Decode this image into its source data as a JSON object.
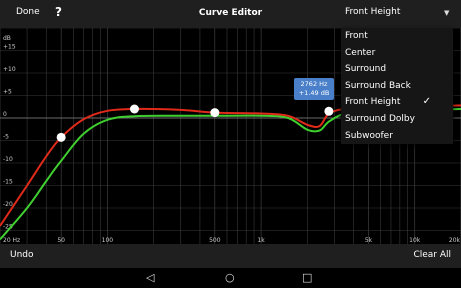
{
  "toolbar": {
    "done_label": "Done",
    "help_label": "?",
    "title": "Curve Editor",
    "preset_value": "Front Height"
  },
  "graph": {
    "y_unit": "dB",
    "y_ticks": [
      "+15",
      "+10",
      "+5",
      "0",
      "-5",
      "-10",
      "-15",
      "-20",
      "-25"
    ],
    "x_ticks": [
      "20 Hz",
      "50",
      "100",
      "500",
      "1k",
      "5k",
      "10k",
      "20k"
    ],
    "colors": {
      "red_curve": "#e02a1a",
      "green_curve": "#3fcf2f",
      "grid": "#3a3a3a"
    },
    "tooltip": {
      "freq": "2762 Hz",
      "gain": "+1.49 dB"
    }
  },
  "chart_data": {
    "type": "line",
    "xscale": "log",
    "xlim": [
      20,
      20000
    ],
    "ylim": [
      -28,
      20
    ],
    "control_points": [
      {
        "x": 50,
        "y": -4.3
      },
      {
        "x": 150,
        "y": 2.0
      },
      {
        "x": 500,
        "y": 1.2
      },
      {
        "x": 2762,
        "y": 1.49
      }
    ],
    "series": [
      {
        "color": "#e02a1a",
        "points": [
          [
            20,
            -24
          ],
          [
            30,
            -15
          ],
          [
            40,
            -8.5
          ],
          [
            50,
            -4.3
          ],
          [
            70,
            -0.3
          ],
          [
            100,
            1.6
          ],
          [
            150,
            2.0
          ],
          [
            300,
            1.8
          ],
          [
            500,
            1.2
          ],
          [
            1000,
            1.0
          ],
          [
            1500,
            0.5
          ],
          [
            2000,
            -1.5
          ],
          [
            2400,
            -1.8
          ],
          [
            2762,
            1.0
          ],
          [
            3500,
            2.0
          ],
          [
            5000,
            2.2
          ],
          [
            10000,
            2.5
          ],
          [
            20000,
            2.8
          ]
        ]
      },
      {
        "color": "#3fcf2f",
        "points": [
          [
            20,
            -27
          ],
          [
            30,
            -20
          ],
          [
            40,
            -14
          ],
          [
            50,
            -9.5
          ],
          [
            70,
            -3.5
          ],
          [
            100,
            -0.4
          ],
          [
            150,
            0.4
          ],
          [
            300,
            0.5
          ],
          [
            500,
            0.5
          ],
          [
            1000,
            0.5
          ],
          [
            1500,
            0.0
          ],
          [
            2000,
            -2.6
          ],
          [
            2400,
            -2.8
          ],
          [
            2762,
            -0.8
          ],
          [
            3500,
            1.0
          ],
          [
            5000,
            1.4
          ],
          [
            10000,
            1.8
          ],
          [
            20000,
            2.0
          ]
        ]
      }
    ]
  },
  "menu": {
    "items": [
      "Front",
      "Center",
      "Surround",
      "Surround Back",
      "Front Height",
      "Surround Dolby",
      "Subwoofer"
    ],
    "selected_index": 4,
    "check_glyph": "✓"
  },
  "bottom": {
    "undo_label": "Undo",
    "clear_label": "Clear All"
  },
  "nav": {
    "back": "◁",
    "home": "○",
    "recents": "□"
  }
}
